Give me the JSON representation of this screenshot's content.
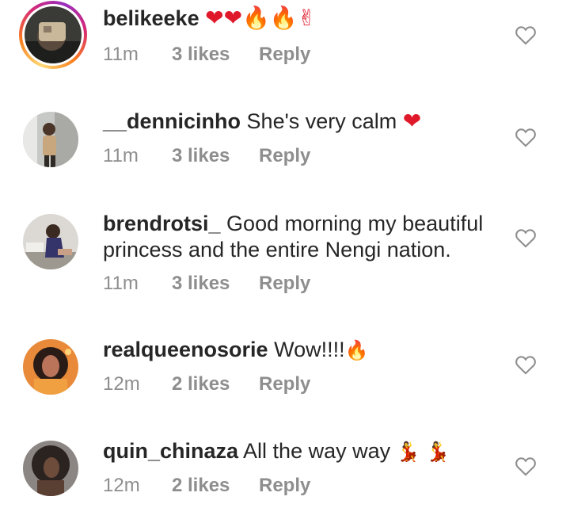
{
  "colors": {
    "text": "#262626",
    "meta": "#8e8e8e",
    "red_heart": "#e0192a",
    "story_ring": "#d62976"
  },
  "comments": [
    {
      "username": "belikeeke",
      "text": "",
      "emojis": "❤❤🔥🔥✌",
      "time": "11m",
      "likes": "3 likes",
      "reply": "Reply",
      "has_story": true
    },
    {
      "username": "__dennicinho",
      "text": "She's very calm",
      "emojis": "❤",
      "time": "11m",
      "likes": "3 likes",
      "reply": "Reply",
      "has_story": false
    },
    {
      "username": "brendrotsi_",
      "text_line1": "Good morning my beautiful",
      "text_line2": "princess and the entire Nengi nation.",
      "time": "11m",
      "likes": "3 likes",
      "reply": "Reply",
      "has_story": false
    },
    {
      "username": "realqueenosorie",
      "text": "Wow!!!!",
      "emojis": "🔥",
      "time": "12m",
      "likes": "2 likes",
      "reply": "Reply",
      "has_story": false
    },
    {
      "username": "quin_chinaza",
      "text": "All the way way",
      "emojis": "💃 💃",
      "time": "12m",
      "likes": "2 likes",
      "reply": "Reply",
      "has_story": false
    }
  ],
  "like_icon": "heart-outline-icon"
}
